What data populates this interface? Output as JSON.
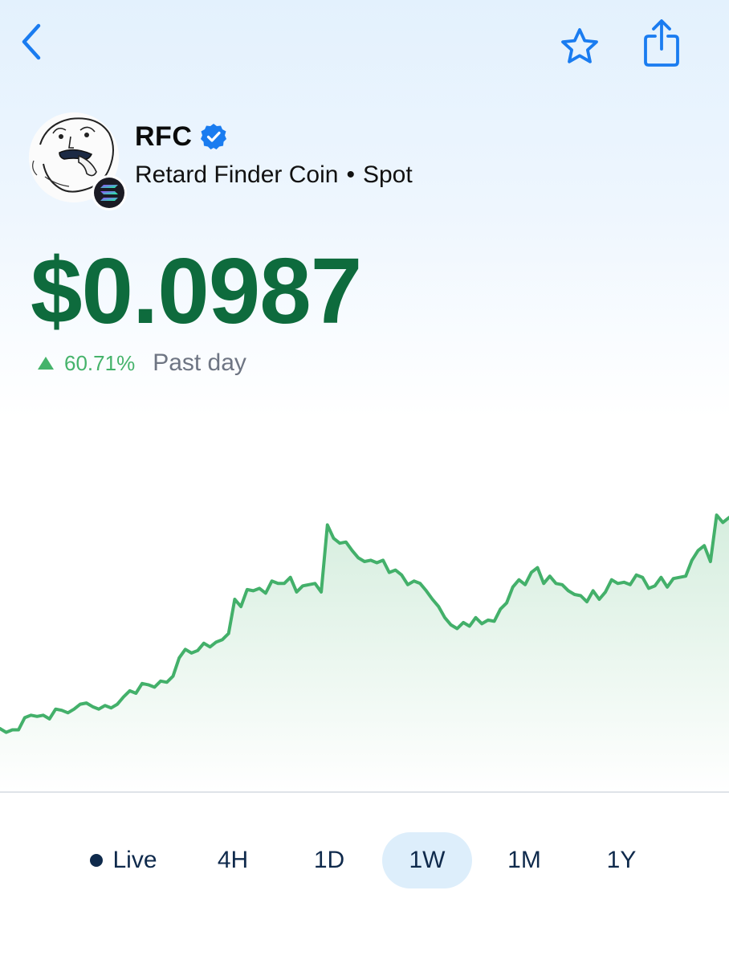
{
  "header": {
    "back_icon": "chevron-left-icon",
    "favorite_icon": "star-outline-icon",
    "share_icon": "share-icon"
  },
  "token": {
    "ticker": "RFC",
    "verified": true,
    "name": "Retard Finder Coin",
    "separator": "•",
    "market": "Spot",
    "chain_icon": "solana-icon"
  },
  "price": {
    "value": "$0.0987",
    "change": "60.71%",
    "direction": "up",
    "period": "Past day"
  },
  "chart_data": {
    "type": "area",
    "title": "",
    "xlabel": "",
    "ylabel": "",
    "y": [
      0.0612,
      0.0609,
      0.0611,
      0.0611,
      0.0621,
      0.0623,
      0.0622,
      0.0623,
      0.062,
      0.0628,
      0.0627,
      0.0625,
      0.0628,
      0.0632,
      0.0633,
      0.063,
      0.0628,
      0.0631,
      0.0629,
      0.0632,
      0.0638,
      0.0643,
      0.0641,
      0.0649,
      0.0648,
      0.0646,
      0.0651,
      0.065,
      0.0655,
      0.067,
      0.0677,
      0.0674,
      0.0676,
      0.0682,
      0.0679,
      0.0683,
      0.0685,
      0.069,
      0.0718,
      0.0712,
      0.0726,
      0.0725,
      0.0727,
      0.0723,
      0.0733,
      0.0731,
      0.0731,
      0.0736,
      0.0724,
      0.0729,
      0.073,
      0.0731,
      0.0724,
      0.0779,
      0.0768,
      0.0764,
      0.0765,
      0.0758,
      0.0752,
      0.0749,
      0.075,
      0.0748,
      0.075,
      0.074,
      0.0742,
      0.0738,
      0.073,
      0.0733,
      0.0731,
      0.0725,
      0.0718,
      0.0712,
      0.0703,
      0.0697,
      0.0694,
      0.0699,
      0.0696,
      0.0703,
      0.0698,
      0.0701,
      0.07,
      0.071,
      0.0715,
      0.0728,
      0.0734,
      0.073,
      0.074,
      0.0744,
      0.0731,
      0.0737,
      0.0731,
      0.073,
      0.0725,
      0.0722,
      0.0721,
      0.0716,
      0.0725,
      0.0718,
      0.0724,
      0.0734,
      0.0731,
      0.0732,
      0.073,
      0.0738,
      0.0736,
      0.0727,
      0.0729,
      0.0736,
      0.0728,
      0.0735,
      0.0736,
      0.0737,
      0.075,
      0.0758,
      0.0762,
      0.0749,
      0.0787,
      0.0781,
      0.0785
    ],
    "ylim": [
      0.056,
      0.088
    ],
    "line_color": "#43b06a",
    "fill_color": "#43b06a",
    "grid": false,
    "legend": "none"
  },
  "ranges": {
    "live": "Live",
    "h4": "4H",
    "d1": "1D",
    "w1": "1W",
    "m1": "1M",
    "y1": "1Y",
    "selected": "1W"
  },
  "colors": {
    "price": "#0e6b3d",
    "up": "#45b36b",
    "accent": "#1a7cf0",
    "range_text": "#0f2a4c",
    "range_active_bg": "#ddeefb"
  }
}
